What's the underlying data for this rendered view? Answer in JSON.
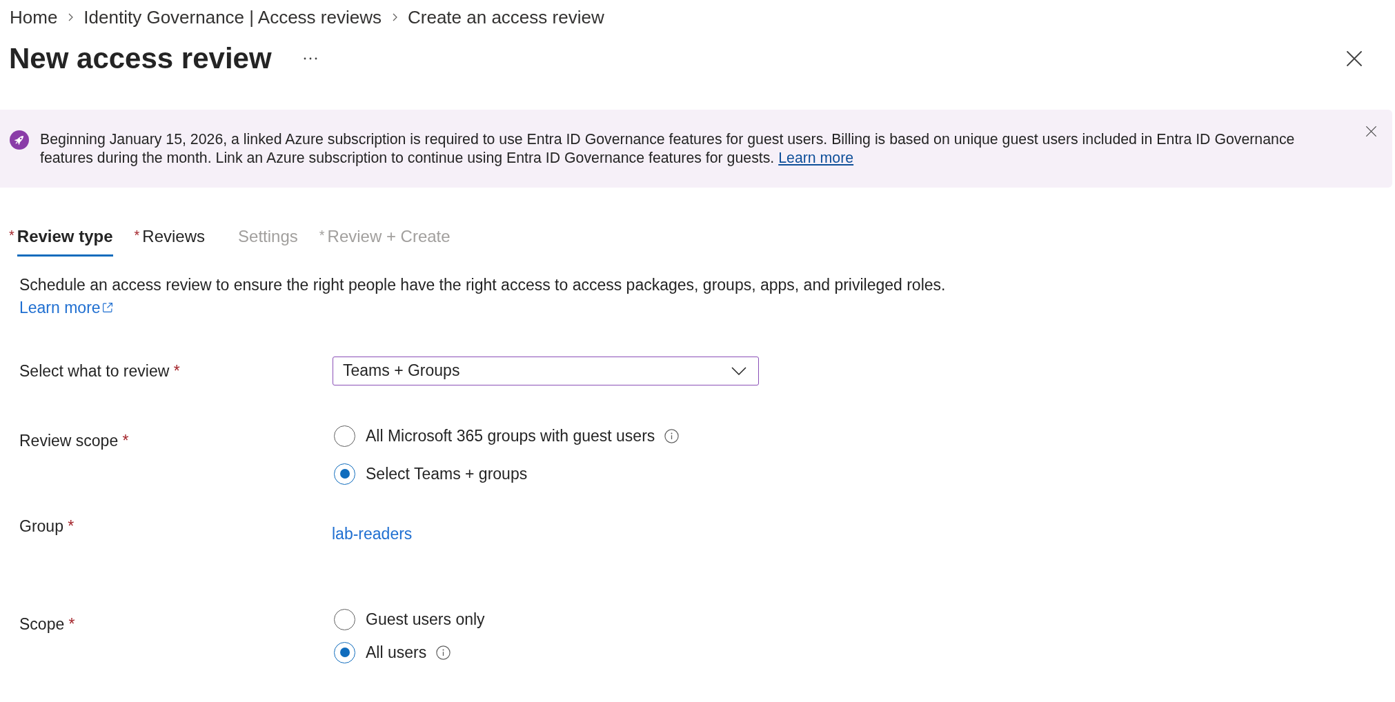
{
  "breadcrumb": [
    {
      "label": "Home"
    },
    {
      "label": "Identity Governance | Access reviews"
    },
    {
      "label": "Create an access review"
    }
  ],
  "header": {
    "title": "New access review"
  },
  "banner": {
    "text": "Beginning January 15, 2026, a linked Azure subscription is required to use Entra ID Governance features for guest users. Billing is based on unique guest users included in Entra ID Governance features during the month. Link an Azure subscription to continue using Entra ID Governance features for guests.",
    "link": "Learn more"
  },
  "tabs": [
    {
      "label": "Review type",
      "marker": "*",
      "selected": true,
      "disabled": false
    },
    {
      "label": "Reviews",
      "marker": "*",
      "selected": false,
      "disabled": false
    },
    {
      "label": "Settings",
      "selected": false,
      "disabled": true
    },
    {
      "label": "Review + Create",
      "marker": "*",
      "selected": false,
      "disabled": true
    }
  ],
  "intro": {
    "text": "Schedule an access review to ensure the right people have the right access to access packages, groups, apps, and privileged roles.",
    "link": "Learn more"
  },
  "fields": [
    {
      "kind": "dropdown",
      "label": "Select what to review",
      "marker": "*",
      "value": "Teams + Groups"
    },
    {
      "kind": "radios",
      "label": "Review scope",
      "marker": "*",
      "options": [
        {
          "label": "All Microsoft 365 groups with guest users",
          "info": true,
          "selected": false
        },
        {
          "label": "Select Teams + groups",
          "info": false,
          "selected": true
        }
      ]
    },
    {
      "kind": "link",
      "label": "Group",
      "marker": "*",
      "value": "lab-readers"
    },
    {
      "kind": "radios",
      "label": "Scope",
      "marker": "*",
      "options": [
        {
          "label": "Guest users only",
          "info": false,
          "selected": false
        },
        {
          "label": "All users",
          "info": true,
          "selected": true
        }
      ]
    }
  ]
}
